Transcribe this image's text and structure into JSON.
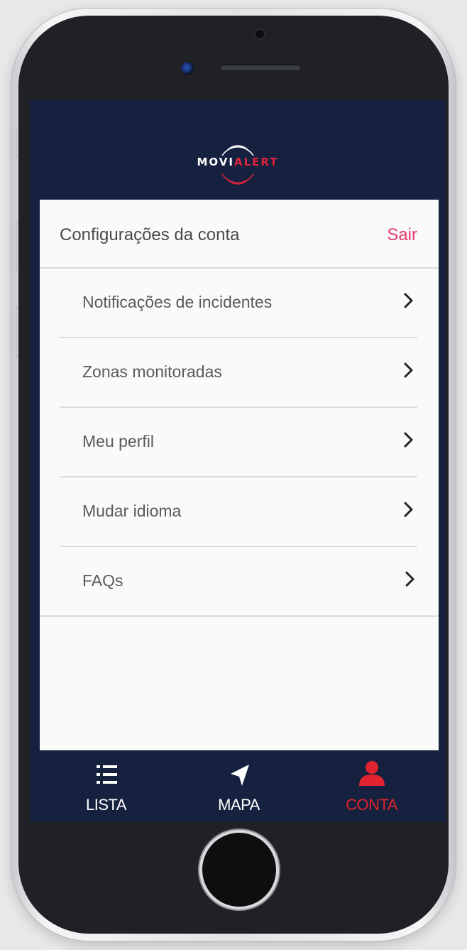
{
  "app": {
    "logo_movi": "MOVI",
    "logo_alert": "ALERT"
  },
  "settings": {
    "title": "Configurações da conta",
    "logout_label": "Sair"
  },
  "menu": {
    "items": [
      {
        "label": "Notificações de incidentes",
        "icon": "chevron-right-icon"
      },
      {
        "label": "Zonas monitoradas",
        "icon": "chevron-right-icon"
      },
      {
        "label": "Meu perfil",
        "icon": "chevron-right-icon"
      },
      {
        "label": "Mudar idioma",
        "icon": "chevron-right-icon"
      },
      {
        "label": "FAQs",
        "icon": "chevron-right-icon"
      }
    ]
  },
  "bottom_nav": {
    "items": [
      {
        "label": "LISTA",
        "icon": "list-icon",
        "active": false
      },
      {
        "label": "MAPA",
        "icon": "navigation-arrow-icon",
        "active": false
      },
      {
        "label": "CONTA",
        "icon": "user-icon",
        "active": true
      }
    ]
  },
  "colors": {
    "header_bg": "#15213e",
    "accent_pink": "#e33a6d",
    "active_red": "#e0232f",
    "content_bg": "#fafafa"
  }
}
